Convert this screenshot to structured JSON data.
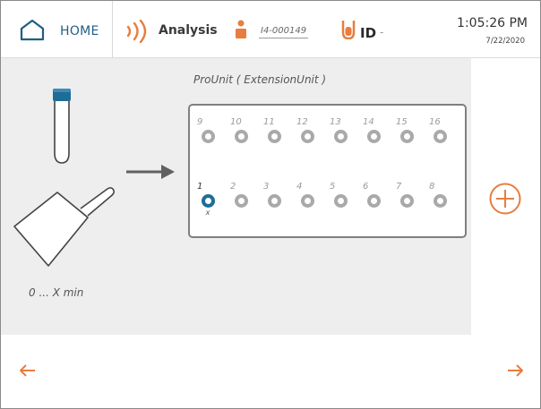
{
  "header": {
    "home_label": "HOME",
    "analysis_label": "Analysis",
    "sample_id": "I4-000149",
    "id_label": "ID",
    "id_value": "-",
    "time": "1:05:26 PM",
    "date": "7/22/2020"
  },
  "main": {
    "unit_title": "ProUnit ( ExtensionUnit )",
    "time_range": "0 ... X min",
    "top_slots": [
      "9",
      "10",
      "11",
      "12",
      "13",
      "14",
      "15",
      "16"
    ],
    "bottom_slots": [
      "1",
      "2",
      "3",
      "4",
      "5",
      "6",
      "7",
      "8"
    ],
    "active_slot_mark": "x"
  },
  "icons": {
    "home": "home-icon",
    "analysis": "signal-waves-icon",
    "person": "person-icon",
    "tube": "test-tube-icon",
    "scoop": "scoop-icon",
    "arrow": "right-arrow-icon",
    "add": "plus-circle-icon",
    "prev": "left-arrow-icon",
    "next": "right-arrow-icon"
  },
  "colors": {
    "accent": "#e87d3e",
    "primary": "#1e6d97",
    "panel": "#eeeeee",
    "slot_inactive": "#a9a9a9"
  }
}
